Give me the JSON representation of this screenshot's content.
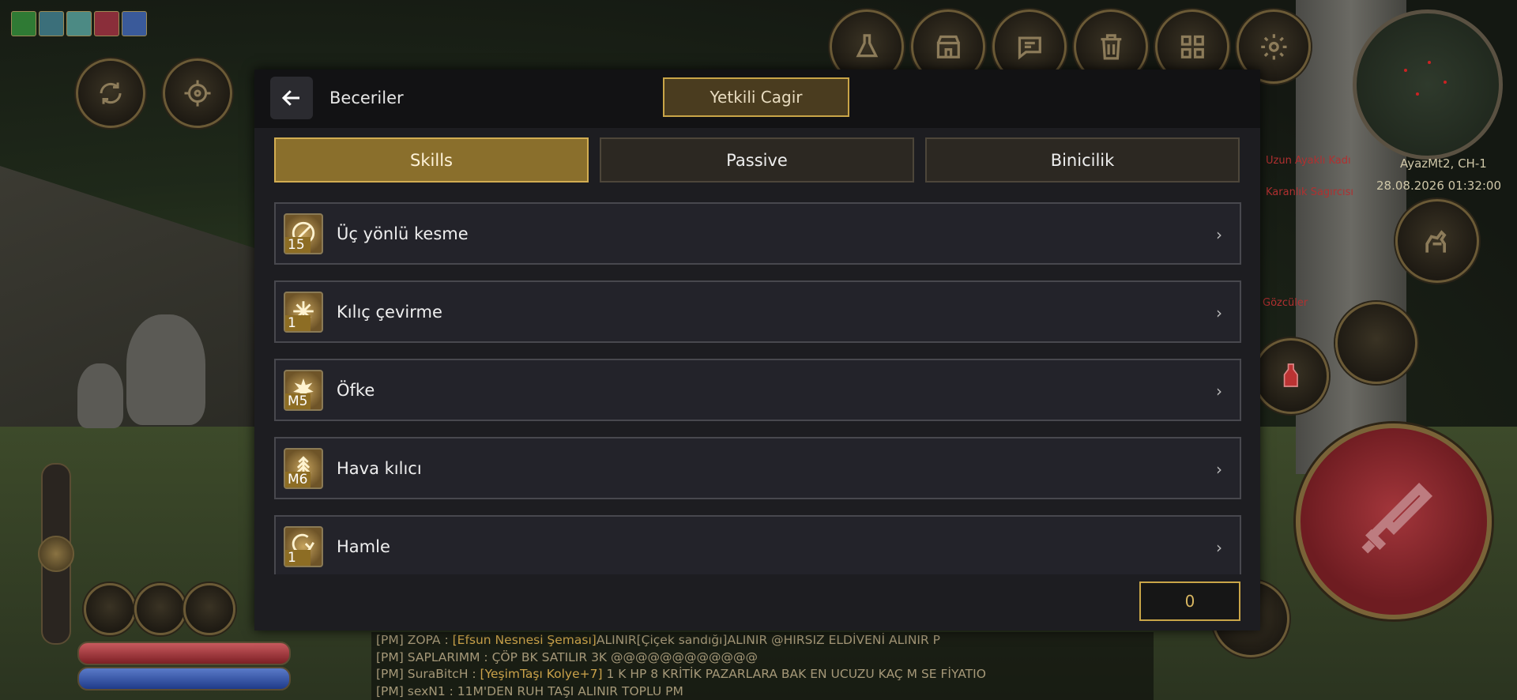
{
  "dialog": {
    "title": "Beceriler",
    "call_gm_label": "Yetkili Cagir",
    "tabs": [
      {
        "label": "Skills",
        "active": true
      },
      {
        "label": "Passive",
        "active": false
      },
      {
        "label": "Binicilik",
        "active": false
      }
    ],
    "skills": [
      {
        "name": "Üç yönlü kesme",
        "level": "15",
        "icon": "sword-slash-icon"
      },
      {
        "name": "Kılıç çevirme",
        "level": "1",
        "icon": "spinning-blade-icon"
      },
      {
        "name": "Öfke",
        "level": "M5",
        "icon": "rage-burst-icon"
      },
      {
        "name": "Hava kılıcı",
        "level": "M6",
        "icon": "air-sword-icon"
      },
      {
        "name": "Hamle",
        "level": "1",
        "icon": "dash-icon"
      }
    ],
    "skill_points": "0"
  },
  "hud": {
    "server_channel": "AyazMt2, CH-1",
    "datetime": "28.08.2026 01:32:00",
    "top_icons": [
      "flask-icon",
      "shop-icon",
      "chat-icon",
      "trash-icon",
      "grid-icon",
      "gear-icon"
    ],
    "name_tags": [
      "Uzun Ayaklı Kadı",
      "Karanlık Sagırcısı",
      "Gözcüler"
    ]
  },
  "chat": [
    {
      "prefix": "[PM] ZOPA : ",
      "highlight": "[Efsun Nesnesi Şeması]",
      "text": "ALINIR[Çiçek sandığı]ALINIR @HIRSIZ ELDİVENİ ALINIR P"
    },
    {
      "prefix": "[PM] SAPLARIMM : ",
      "highlight": "",
      "text": " ÇÖP BK SATILIR 3K @@@@@@@@@@@@"
    },
    {
      "prefix": "[PM] SuraBitcH : ",
      "highlight": "[YeşimTaşı Kolye+7]",
      "text": " 1 K HP 8 KRİTİK PAZARLARA BAK EN UCUZU KAÇ M SE FİYATIO"
    },
    {
      "prefix": "[PM] sexN1 : ",
      "highlight": "",
      "text": "11M'DEN RUH TAŞI ALINIR TOPLU PM"
    }
  ],
  "colors": {
    "accent_gold": "#c9a548",
    "active_tab": "#8a6f2c",
    "attack_red": "#a3363b"
  }
}
